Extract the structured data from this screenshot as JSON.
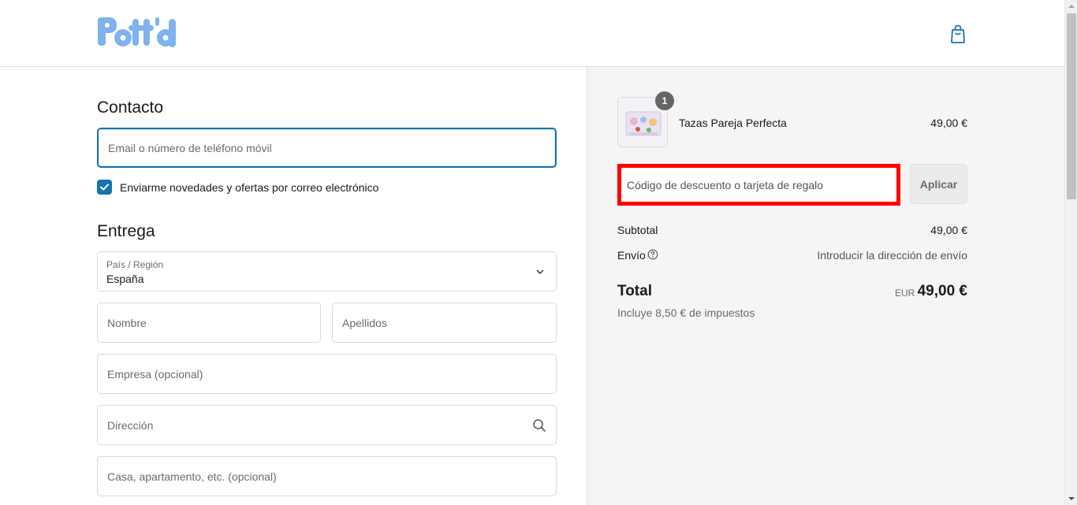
{
  "header": {
    "logo_text": "Pott'd",
    "logo_color": "#7fb2ee",
    "cart_icon": "shopping-bag-icon"
  },
  "contact": {
    "title": "Contacto",
    "email_placeholder": "Email o número de teléfono móvil",
    "newsletter_checked": true,
    "newsletter_label": "Enviarme novedades y ofertas por correo electrónico"
  },
  "delivery": {
    "title": "Entrega",
    "country_label": "País / Región",
    "country_value": "España",
    "first_name_placeholder": "Nombre",
    "last_name_placeholder": "Apellidos",
    "company_placeholder": "Empresa (opcional)",
    "address_placeholder": "Dirección",
    "apartment_placeholder": "Casa, apartamento, etc. (opcional)"
  },
  "summary": {
    "product": {
      "name": "Tazas Pareja Perfecta",
      "price": "49,00 €",
      "quantity": "1"
    },
    "discount_placeholder": "Código de descuento o tarjeta de regalo",
    "apply_label": "Aplicar",
    "subtotal_label": "Subtotal",
    "subtotal_value": "49,00 €",
    "shipping_label": "Envío",
    "shipping_value": "Introducir la dirección de envío",
    "total_label": "Total",
    "total_currency": "EUR",
    "total_value": "49,00 €",
    "tax_note": "Incluye 8,50 € de impuestos"
  },
  "colors": {
    "accent": "#1773b0",
    "highlight": "#ff0000",
    "panel_bg": "#f5f5f5"
  }
}
